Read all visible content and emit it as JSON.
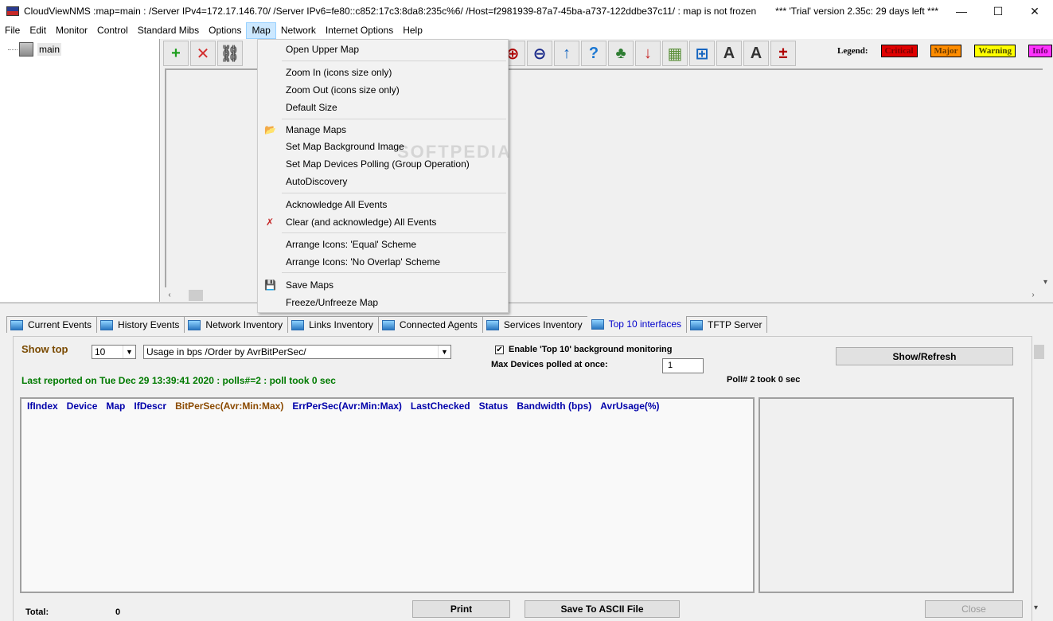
{
  "window": {
    "title": "CloudViewNMS :map=main :  /Server IPv4=172.17.146.70/ /Server IPv6=fe80::c852:17c3:8da8:235c%6/ /Host=f2981939-87a7-45ba-a737-122ddbe37c11/  : map is not frozen",
    "trial": "*** 'Trial' version 2.35c: 29 days left ***",
    "controls": {
      "minimize": "—",
      "maximize": "☐",
      "close": "✕"
    }
  },
  "menubar": [
    "File",
    "Edit",
    "Monitor",
    "Control",
    "Standard Mibs",
    "Options",
    "Map",
    "Network",
    "Internet Options",
    "Help"
  ],
  "tree": {
    "root_label": "main"
  },
  "toolbar": {
    "buttons": [
      {
        "name": "add-icon",
        "glyph": "+",
        "color": "#1e9e1e"
      },
      {
        "name": "delete-icon",
        "glyph": "✕",
        "color": "#d32f2f"
      },
      {
        "name": "link-add-icon",
        "glyph": "⛓",
        "color": "#555555"
      },
      {
        "name": "zoom-in-icon",
        "glyph": "⊕",
        "color": "#b00000"
      },
      {
        "name": "zoom-out-icon",
        "glyph": "⊖",
        "color": "#1a2a8a"
      },
      {
        "name": "up-arrow-icon",
        "glyph": "↑",
        "color": "#1565c0"
      },
      {
        "name": "help-icon",
        "glyph": "?",
        "color": "#1976d2"
      },
      {
        "name": "tree-icon",
        "glyph": "♣",
        "color": "#2e7d32"
      },
      {
        "name": "download-icon",
        "glyph": "↓",
        "color": "#c62828"
      },
      {
        "name": "map-image-icon",
        "glyph": "▦",
        "color": "#5a8f3a"
      },
      {
        "name": "grid-icon",
        "glyph": "⊞",
        "color": "#1565c0"
      },
      {
        "name": "zoom-in-labels-icon",
        "glyph": "A",
        "color": "#333333"
      },
      {
        "name": "zoom-out-labels-icon",
        "glyph": "A",
        "color": "#333333"
      },
      {
        "name": "zoom-default-icon",
        "glyph": "±",
        "color": "#b00000"
      }
    ],
    "legend": {
      "title": "Legend:",
      "items": [
        {
          "label": "Critical",
          "bg": "#e00000",
          "fg": "#7a0000"
        },
        {
          "label": "Major",
          "bg": "#ff8c00",
          "fg": "#6a3a00"
        },
        {
          "label": "Warning",
          "bg": "#ffff00",
          "fg": "#4a4a00"
        },
        {
          "label": "Info",
          "bg": "#ff33ff",
          "fg": "#6a006a"
        }
      ]
    }
  },
  "map_menu": {
    "items": [
      {
        "label": "Open Upper Map",
        "icon": ""
      },
      {
        "label": "Zoom In (icons size only)",
        "icon": ""
      },
      {
        "label": "Zoom Out (icons size only)",
        "icon": ""
      },
      {
        "label": "Default Size",
        "icon": ""
      },
      {
        "label": "Manage Maps",
        "icon": "📂"
      },
      {
        "label": "Set Map Background Image",
        "icon": ""
      },
      {
        "label": "Set Map Devices Polling (Group Operation)",
        "icon": ""
      },
      {
        "label": "AutoDiscovery",
        "icon": ""
      },
      {
        "label": "Acknowledge All Events",
        "icon": ""
      },
      {
        "label": "Clear (and acknowledge) All Events",
        "icon": "✗"
      },
      {
        "label": "Arrange Icons: 'Equal' Scheme",
        "icon": ""
      },
      {
        "label": "Arrange Icons: 'No Overlap' Scheme",
        "icon": ""
      },
      {
        "label": "Save Maps",
        "icon": "💾"
      },
      {
        "label": "Freeze/Unfreeze Map",
        "icon": ""
      }
    ],
    "watermark": "SOFTPEDIA"
  },
  "tabs": [
    {
      "label": "Current Events",
      "active": false
    },
    {
      "label": "History Events",
      "active": false
    },
    {
      "label": "Network Inventory",
      "active": false
    },
    {
      "label": "Links Inventory",
      "active": false
    },
    {
      "label": "Connected Agents",
      "active": false
    },
    {
      "label": "Services Inventory",
      "active": false
    },
    {
      "label": "Top 10 interfaces",
      "active": true
    },
    {
      "label": "TFTP Server",
      "active": false
    }
  ],
  "top10": {
    "show_top_label": "Show top",
    "show_top_value": "10",
    "order_value": "Usage in bps /Order by AvrBitPerSec/",
    "enable_bg_label": "Enable 'Top 10' background monitoring",
    "enable_bg_checked": "✔",
    "max_devices_label": "Max Devices polled at once:",
    "max_devices_value": "1",
    "show_refresh": "Show/Refresh",
    "last_reported": "Last reported on Tue Dec 29 13:39:41 2020 : polls#=2 : poll took 0 sec",
    "poll_info": "Poll# 2 took 0 sec",
    "columns": [
      "IfIndex",
      "Device",
      "Map",
      "IfDescr",
      "BitPerSec(Avr:Min:Max)",
      "ErrPerSec(Avr:Min:Max)",
      "LastChecked",
      "Status",
      "Bandwidth (bps)",
      "AvrUsage(%)"
    ],
    "total_label": "Total:",
    "total_value": "0",
    "print": "Print",
    "save_ascii": "Save To ASCII File",
    "close": "Close"
  }
}
